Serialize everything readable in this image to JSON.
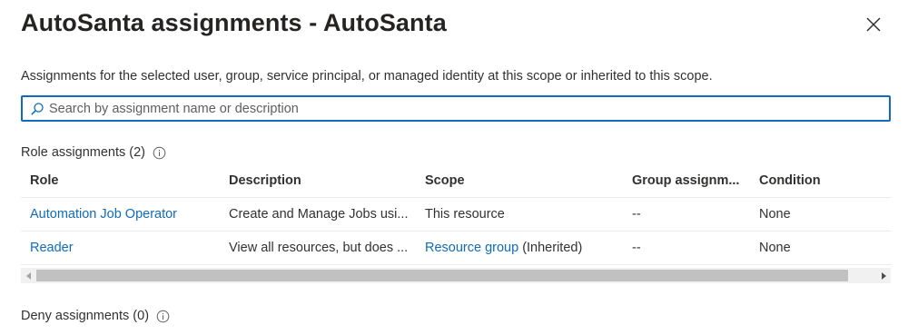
{
  "header": {
    "title": "AutoSanta assignments - AutoSanta"
  },
  "description": "Assignments for the selected user, group, service principal, or managed identity at this scope or inherited to this scope.",
  "search": {
    "placeholder": "Search by assignment name or description",
    "value": ""
  },
  "role_assignments": {
    "label": "Role assignments (2)",
    "columns": [
      "Role",
      "Description",
      "Scope",
      "Group assignm...",
      "Condition"
    ],
    "rows": [
      {
        "role": "Automation Job Operator",
        "description": "Create and Manage Jobs usi...",
        "scope_link": "This resource",
        "scope_suffix": "",
        "group_assignment": "--",
        "condition": "None"
      },
      {
        "role": "Reader",
        "description": "View all resources, but does ...",
        "scope_link": "Resource group",
        "scope_suffix": " (Inherited)",
        "group_assignment": "--",
        "condition": "None"
      }
    ]
  },
  "deny_assignments": {
    "label": "Deny assignments (0)"
  },
  "colors": {
    "link": "#0f6cbd",
    "search_border": "#0f6cbd",
    "text": "#323130"
  },
  "icons": {
    "close": "close-icon",
    "search": "search-icon",
    "info": "info-icon"
  }
}
